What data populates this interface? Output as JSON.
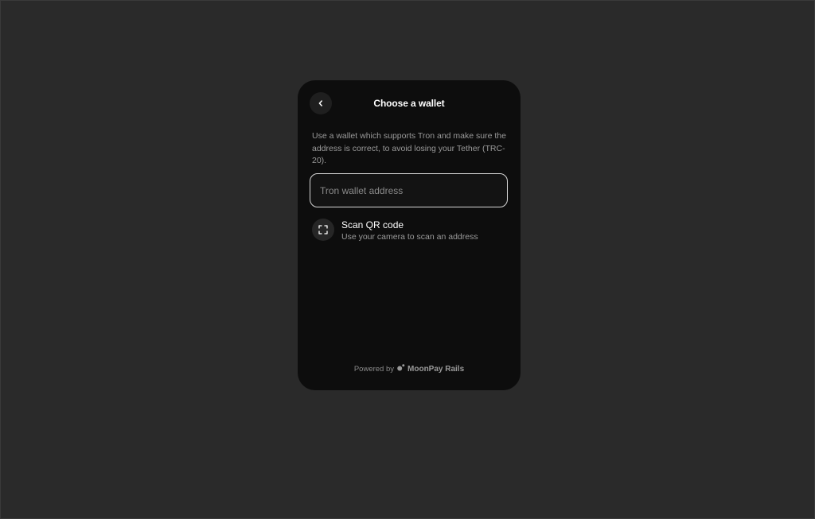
{
  "header": {
    "title": "Choose a wallet",
    "back_icon": "chevron-left-icon"
  },
  "description": "Use a wallet which supports Tron and make sure the address is correct, to avoid losing your Tether (TRC-20).",
  "wallet_input": {
    "placeholder": "Tron wallet address",
    "value": ""
  },
  "scan": {
    "icon": "scan-frame-icon",
    "title": "Scan QR code",
    "subtitle": "Use your camera to scan an address"
  },
  "footer": {
    "powered_by": "Powered by",
    "brand": "MoonPay Rails",
    "brand_icon": "moonpay-logo-icon"
  },
  "colors": {
    "background": "#2a2a2a",
    "widget": "#0d0d0d",
    "text_primary": "#ffffff",
    "text_secondary": "#9a9a9a",
    "input_border": "#d6d6d6"
  }
}
